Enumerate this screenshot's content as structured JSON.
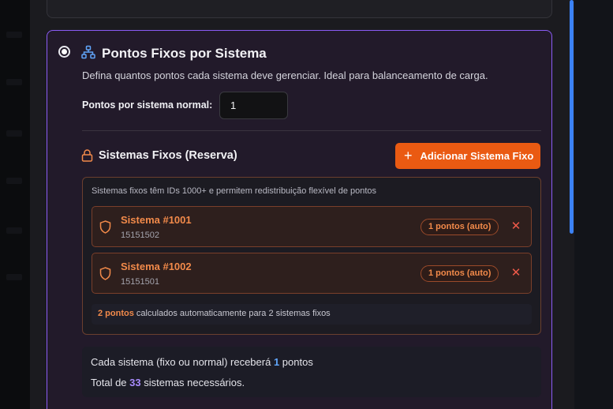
{
  "card": {
    "title": "Pontos Fixos por Sistema",
    "description": "Defina quantos pontos cada sistema deve gerenciar. Ideal para balanceamento de carga.",
    "field_label": "Pontos por sistema normal:",
    "field_value": "1"
  },
  "reserve": {
    "title": "Sistemas Fixos (Reserva)",
    "add_button": "Adicionar Sistema Fixo",
    "note": "Sistemas fixos têm IDs 1000+ e permitem redistribuição flexível de pontos",
    "items": [
      {
        "name": "Sistema #1001",
        "code": "15151502",
        "badge": "1 pontos (auto)"
      },
      {
        "name": "Sistema #1002",
        "code": "15151501",
        "badge": "1 pontos (auto)"
      }
    ],
    "calc_highlight": "2 pontos",
    "calc_rest": " calculados automaticamente para 2 sistemas fixos"
  },
  "summary": {
    "line1_prefix": "Cada sistema (fixo ou normal) receberá ",
    "line1_value": "1",
    "line1_suffix": " pontos",
    "line2_prefix": "Total de ",
    "line2_value": "33",
    "line2_suffix": " sistemas necessários."
  },
  "colors": {
    "accent_purple": "#8b5cf6",
    "accent_orange": "#ea5a12",
    "highlight_blue": "#60a5fa",
    "highlight_purple": "#a78bfa"
  }
}
